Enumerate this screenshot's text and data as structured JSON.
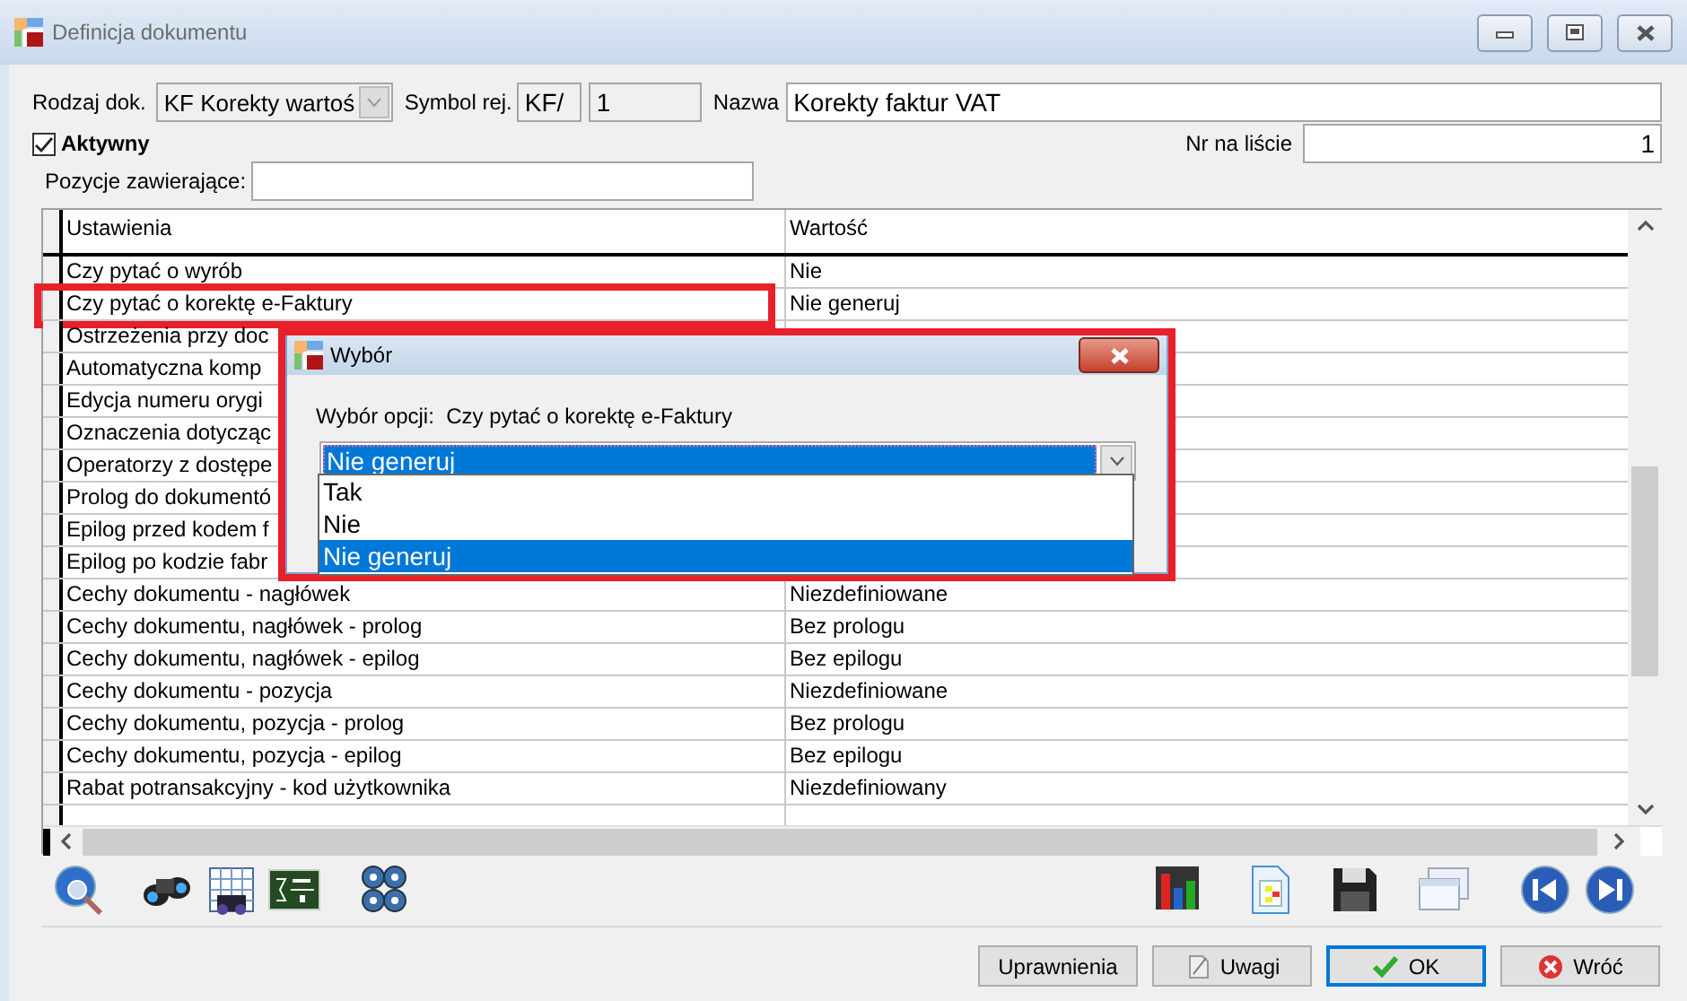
{
  "window": {
    "title": "Definicja dokumentu"
  },
  "form": {
    "rodzaj_label": "Rodzaj dok.",
    "rodzaj_value": "KF Korekty wartoś",
    "symbol_label": "Symbol rej.",
    "symbol_prefix": "KF/",
    "symbol_number": "1",
    "nazwa_label": "Nazwa",
    "nazwa_value": "Korekty faktur VAT",
    "aktywny": {
      "label": "Aktywny",
      "checked": true
    },
    "nr_label": "Nr na liście",
    "nr_value": "1",
    "pozycje_label": "Pozycje zawierające:"
  },
  "table": {
    "columns": [
      "Ustawienia",
      "Wartość"
    ],
    "rows": [
      {
        "setting": "Czy pytać o wyrób",
        "value": "Nie",
        "highlighted": false
      },
      {
        "setting": "Czy pytać o korektę e-Faktury",
        "value": "Nie generuj",
        "highlighted": true
      },
      {
        "setting": "Ostrzeżenia przy doc",
        "highlighted": false
      },
      {
        "setting": "Automatyczna komp",
        "highlighted": false
      },
      {
        "setting": "Edycja numeru orygi",
        "highlighted": false
      },
      {
        "setting": "Oznaczenia dotycząc",
        "highlighted": false
      },
      {
        "setting": "Operatorzy z dostępe",
        "highlighted": false
      },
      {
        "setting": "Prolog do dokumentó",
        "highlighted": false
      },
      {
        "setting": "Epilog przed kodem f",
        "highlighted": false
      },
      {
        "setting": "Epilog po kodzie fabr",
        "highlighted": false
      },
      {
        "setting": "Cechy dokumentu - nagłówek",
        "value": "Niezdefiniowane",
        "highlighted": false
      },
      {
        "setting": "Cechy dokumentu, nagłówek - prolog",
        "value": "Bez prologu",
        "highlighted": false
      },
      {
        "setting": "Cechy dokumentu, nagłówek - epilog",
        "value": "Bez epilogu",
        "highlighted": false
      },
      {
        "setting": "Cechy dokumentu - pozycja",
        "value": "Niezdefiniowane",
        "highlighted": false
      },
      {
        "setting": "Cechy dokumentu, pozycja - prolog",
        "value": "Bez prologu",
        "highlighted": false
      },
      {
        "setting": "Cechy dokumentu, pozycja - epilog",
        "value": "Bez epilogu",
        "highlighted": false
      },
      {
        "setting": "Rabat potransakcyjny - kod użytkownika",
        "value": "Niezdefiniowany",
        "highlighted": false
      }
    ]
  },
  "dialog": {
    "title": "Wybór",
    "prompt": "Wybór opcji:  Czy pytać o korektę e-Faktury",
    "combo_value": "Nie generuj",
    "highlighted": true,
    "options": [
      {
        "label": "Tak",
        "selected": false
      },
      {
        "label": "Nie",
        "selected": false
      },
      {
        "label": "Nie generuj",
        "selected": true
      }
    ]
  },
  "buttons": [
    {
      "label": "Uprawnienia",
      "kind": "plain",
      "default": false
    },
    {
      "label": "Uwagi",
      "kind": "note",
      "default": false
    },
    {
      "label": "OK",
      "kind": "confirm",
      "default": true
    },
    {
      "label": "Wróć",
      "kind": "cancel",
      "default": false
    }
  ]
}
